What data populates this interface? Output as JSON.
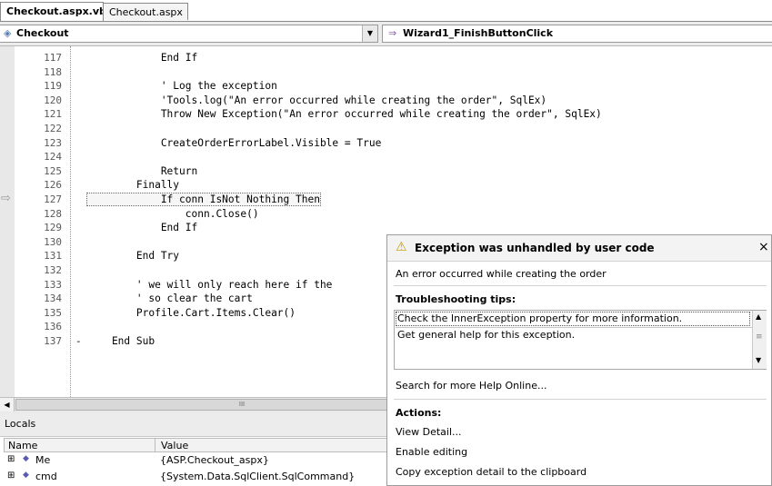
{
  "tabs": [
    {
      "label": "Checkout.aspx.vb",
      "active": true
    },
    {
      "label": "Checkout.aspx",
      "active": false
    }
  ],
  "navbar": {
    "class_label": "Checkout",
    "method_label": "Wizard1_FinishButtonClick",
    "dropdown_glyph": "▼"
  },
  "editor": {
    "lines": [
      {
        "num": "117",
        "code": "            End If"
      },
      {
        "num": "118",
        "code": ""
      },
      {
        "num": "119",
        "code": "            ' Log the exception"
      },
      {
        "num": "120",
        "code": "            'Tools.log(\"An error occurred while creating the order\", SqlEx)"
      },
      {
        "num": "121",
        "code": "            Throw New Exception(\"An error occurred while creating the order\", SqlEx)"
      },
      {
        "num": "122",
        "code": ""
      },
      {
        "num": "123",
        "code": "            CreateOrderErrorLabel.Visible = True"
      },
      {
        "num": "124",
        "code": ""
      },
      {
        "num": "125",
        "code": "            Return"
      },
      {
        "num": "126",
        "code": "        Finally"
      },
      {
        "num": "127",
        "code": "            If conn IsNot Nothing Then"
      },
      {
        "num": "128",
        "code": "                conn.Close()"
      },
      {
        "num": "129",
        "code": "            End If"
      },
      {
        "num": "130",
        "code": ""
      },
      {
        "num": "131",
        "code": "        End Try"
      },
      {
        "num": "132",
        "code": ""
      },
      {
        "num": "133",
        "code": "        ' we will only reach here if the"
      },
      {
        "num": "134",
        "code": "        ' so clear the cart"
      },
      {
        "num": "135",
        "code": "        Profile.Cart.Items.Clear()"
      },
      {
        "num": "136",
        "code": ""
      },
      {
        "num": "137",
        "code": "    End Sub"
      }
    ],
    "current_line_arrow": "⇨",
    "collapse_glyph": "-"
  },
  "scrollbar": {
    "left_arrow": "◀",
    "thumb_grip": "III"
  },
  "locals": {
    "title": "Locals",
    "columns": [
      "Name",
      "Value"
    ],
    "rows": [
      {
        "expander": "⊞",
        "name": "Me",
        "value": "{ASP.Checkout_aspx}"
      },
      {
        "expander": "⊞",
        "name": "cmd",
        "value": "{System.Data.SqlClient.SqlCommand}"
      }
    ]
  },
  "exception": {
    "warning_icon": "⚠",
    "title": "Exception was unhandled by user code",
    "close_glyph": "×",
    "message": "An error occurred while creating the order",
    "tips_heading": "Troubleshooting tips:",
    "tips": [
      "Check the InnerException property for more information.",
      "Get general help for this exception."
    ],
    "search_link": "Search for more Help Online...",
    "actions_heading": "Actions:",
    "actions": [
      "View Detail...",
      "Enable editing",
      "Copy exception detail to the clipboard"
    ],
    "scroll_up": "▲",
    "scroll_down": "▼",
    "scroll_grip": "≡"
  }
}
